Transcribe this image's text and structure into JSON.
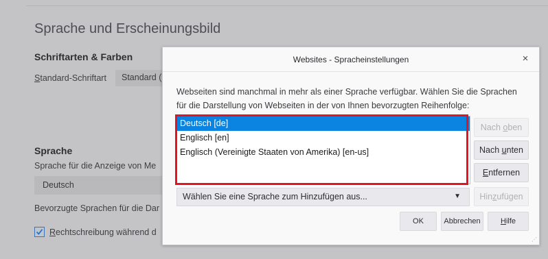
{
  "background": {
    "section_title": "Sprache und Erscheinungsbild",
    "fonts_heading": "Schriftarten & Farben",
    "default_font_label_u": "S",
    "default_font_label_rest": "tandard-Schriftart",
    "default_font_value": "Standard (",
    "language_heading": "Sprache",
    "language_display_label": "Sprache für die Anzeige von Me",
    "language_value": "Deutsch",
    "preferred_languages_label": "Bevorzugte Sprachen für die Dar",
    "spellcheck_label_u": "R",
    "spellcheck_label_rest": "echtschreibung während d",
    "spellcheck_checked": true
  },
  "dialog": {
    "title": "Websites - Spracheinstellungen",
    "close_glyph": "×",
    "description_line1": "Webseiten sind manchmal in mehr als einer Sprache verfügbar. Wählen Sie die Sprachen",
    "description_line2": "für die Darstellung von Webseiten in der von Ihnen bevorzugten Reihenfolge:",
    "languages": [
      {
        "label": "Deutsch  [de]",
        "selected": true
      },
      {
        "label": "Englisch  [en]",
        "selected": false
      },
      {
        "label": "Englisch (Vereinigte Staaten von Amerika)  [en-us]",
        "selected": false
      }
    ],
    "move_up": {
      "pre": "Nach ",
      "u": "o",
      "post": "ben",
      "disabled": true
    },
    "move_down": {
      "pre": "Nach ",
      "u": "u",
      "post": "nten",
      "disabled": false
    },
    "remove": {
      "pre": "",
      "u": "E",
      "post": "ntfernen",
      "disabled": false
    },
    "add_select_placeholder": "Wählen Sie eine Sprache zum Hinzufügen aus...",
    "add_select_arrow": "▼",
    "add_button": {
      "pre": "Hin",
      "u": "z",
      "post": "ufügen",
      "disabled": true
    },
    "ok_label": "OK",
    "cancel_label": "Abbrechen",
    "help": {
      "pre": "",
      "u": "H",
      "post": "ilfe"
    }
  },
  "colors": {
    "selection": "#0a84e0",
    "highlight_box": "#e3141f",
    "checkbox_accent": "#3c73b6"
  }
}
